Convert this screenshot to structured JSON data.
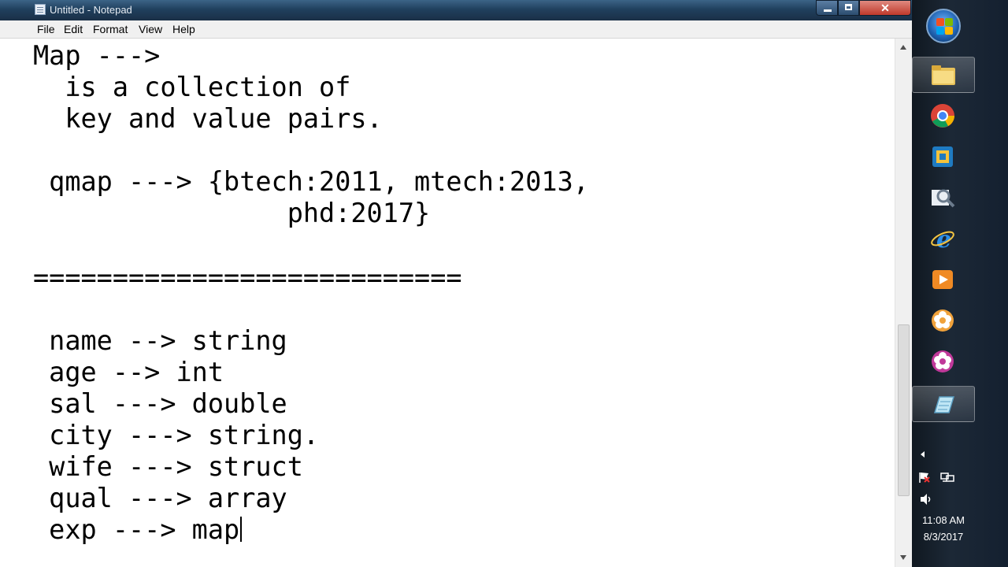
{
  "window": {
    "title": "Untitled - Notepad",
    "controls": {
      "minimize": "",
      "maximize": "",
      "close": "✕"
    }
  },
  "menu": [
    "File",
    "Edit",
    "Format",
    "View",
    "Help"
  ],
  "editor": {
    "lines": [
      "Map --->",
      "  is a collection of",
      "  key and value pairs.",
      "",
      " qmap ---> {btech:2011, mtech:2013,",
      "                phd:2017}",
      "",
      "===========================",
      "",
      " name --> string",
      " age --> int",
      " sal ---> double",
      " city ---> string.",
      " wife ---> struct",
      " qual ---> array",
      " exp ---> map"
    ]
  },
  "taskbar": {
    "apps": [
      {
        "icon": "windows-explorer-folder-icon",
        "active": true
      },
      {
        "icon": "chrome-icon",
        "active": false
      },
      {
        "icon": "virtualbox-icon",
        "active": false
      },
      {
        "icon": "magnifier-icon",
        "active": false
      },
      {
        "icon": "internet-explorer-icon",
        "active": false
      },
      {
        "icon": "media-player-icon",
        "active": false
      },
      {
        "icon": "flower-app-orange-icon",
        "active": false
      },
      {
        "icon": "flower-app-pink-icon",
        "active": false
      },
      {
        "icon": "notepad-icon",
        "active": true
      }
    ],
    "clock": {
      "time": "11:08 AM",
      "date": "8/3/2017"
    }
  }
}
